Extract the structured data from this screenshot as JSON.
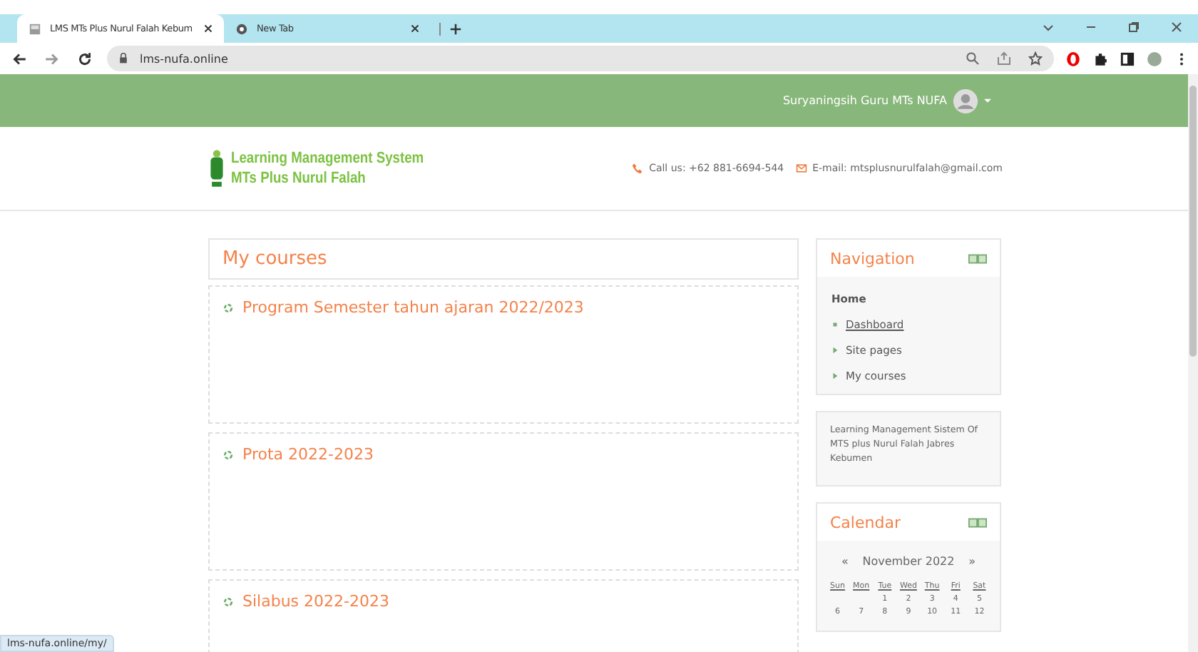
{
  "browser": {
    "tabs": [
      {
        "title": "LMS MTs Plus Nurul Falah Kebum",
        "selected": true
      },
      {
        "title": "New Tab",
        "selected": false
      }
    ],
    "url": "lms-nufa.online"
  },
  "header": {
    "user": "Suryaningsih Guru MTs NUFA",
    "logo_line_1": "Learning Management System",
    "logo_line_2": "MTs Plus Nurul Falah",
    "phone": "Call us: +62 881-6694-544",
    "email": "E-mail: mtsplusnurulfalah@gmail.com"
  },
  "main": {
    "title": "My courses",
    "courses": [
      "Program Semester tahun ajaran 2022/2023",
      "Prota 2022-2023",
      "Silabus 2022-2023"
    ]
  },
  "navigation": {
    "title": "Navigation",
    "home": "Home",
    "items": [
      {
        "label": "Dashboard",
        "kind": "link"
      },
      {
        "label": "Site pages",
        "kind": "branch"
      },
      {
        "label": "My courses",
        "kind": "branch"
      }
    ]
  },
  "about": "Learning Management Sistem Of MTS plus Nurul Falah Jabres Kebumen",
  "calendar": {
    "title": "Calendar",
    "prev": "«",
    "month": "November 2022",
    "next": "»",
    "weekdays": [
      "Sun",
      "Mon",
      "Tue",
      "Wed",
      "Thu",
      "Fri",
      "Sat"
    ],
    "weeks": [
      {
        "kind": "partial_start",
        "days": [
          "1",
          "2",
          "3",
          "4",
          "5"
        ]
      },
      {
        "kind": "full",
        "days": [
          "6",
          "7",
          "8",
          "9",
          "10",
          "11",
          "12"
        ]
      }
    ]
  },
  "status_url": "lms-nufa.online/my/"
}
